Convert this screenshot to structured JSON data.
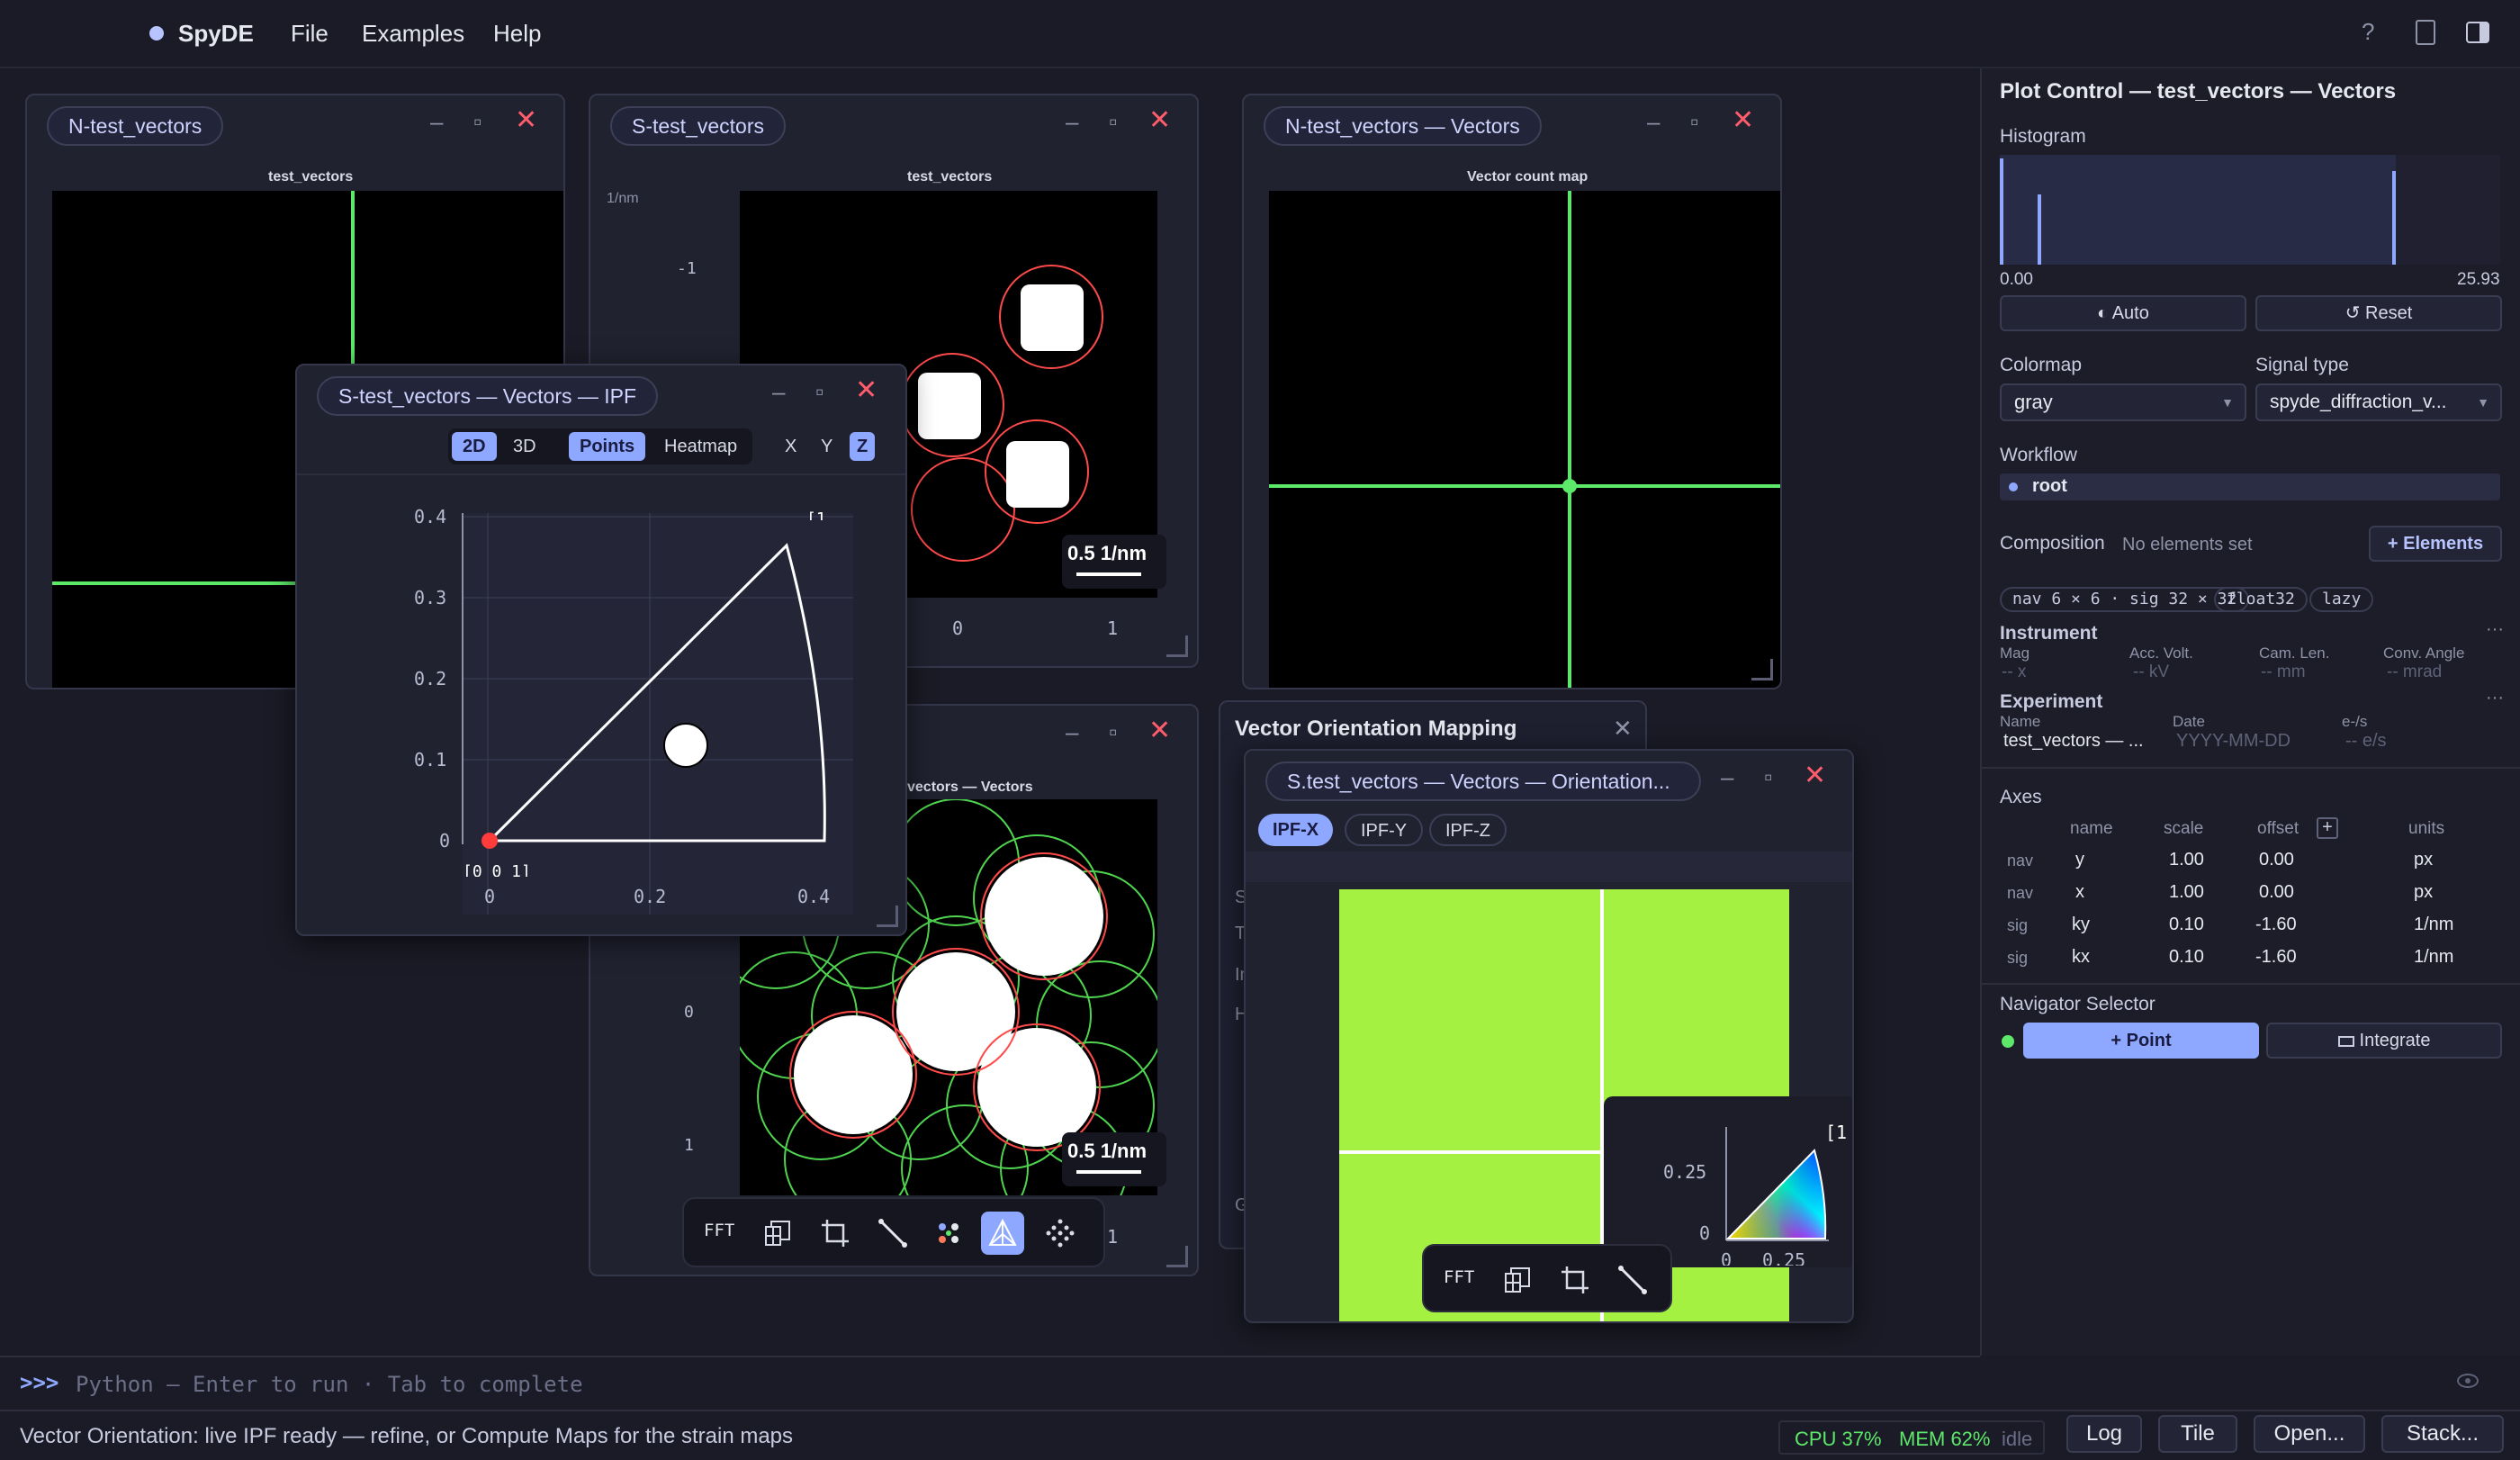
{
  "app": {
    "name": "SpyDE",
    "menu": [
      "File",
      "Examples",
      "Help"
    ],
    "accent": "#8fa8ff"
  },
  "header_icons": [
    "help-icon",
    "document-icon",
    "sidebar-toggle-icon"
  ],
  "windows": {
    "n_vectors": {
      "tab": "N-test_vectors",
      "title": "test_vectors"
    },
    "s_vectors": {
      "tab": "S-test_vectors",
      "title": "test_vectors",
      "unit": "1/nm",
      "y_tick": "-1",
      "x_ticks": [
        "0",
        "1"
      ],
      "scalebar": "0.5 1/nm"
    },
    "n_vectors_vec": {
      "tab": "N-test_vectors — Vectors",
      "title": "Vector count map"
    },
    "ipf": {
      "tab": "S-test_vectors — Vectors — IPF",
      "modes": [
        "2D",
        "3D",
        "Points",
        "Heatmap",
        "X",
        "Y",
        "Z"
      ],
      "y_ticks": [
        "0.4",
        "0.3",
        "0.2",
        "0.1",
        "0"
      ],
      "x_ticks": [
        "0",
        "0.2",
        "0.4"
      ],
      "corner_label": "[0 0 1]",
      "corner_label_top": "[1",
      "point": {
        "x": 0.24,
        "y": 0.12
      }
    },
    "s_vectors_vec": {
      "title": "vectors — Vectors",
      "y_ticks": [
        "0",
        "1"
      ],
      "x_tick": "1",
      "scalebar": "0.5 1/nm"
    },
    "vom": {
      "title": "Vector Orientation Mapping",
      "side_letters": [
        "S",
        "T",
        "In",
        "H",
        "G"
      ]
    },
    "orientation": {
      "tab": "S.test_vectors — Vectors — Orientation...",
      "tabs": [
        "IPF-X",
        "IPF-Y",
        "IPF-Z"
      ],
      "key_y_ticks": [
        "0.25",
        "0"
      ],
      "key_x_ticks": [
        "0",
        "0.25"
      ],
      "key_label": "[1"
    }
  },
  "toolbar": {
    "fft": "FFT",
    "icons": [
      "symmetry-icon",
      "crop-icon",
      "line-icon",
      "vectors-icon",
      "ipf-icon",
      "grid-points-icon"
    ]
  },
  "toolbar2": {
    "fft": "FFT",
    "icons": [
      "symmetry-icon",
      "crop-icon",
      "line-icon"
    ]
  },
  "panel": {
    "title": "Plot Control — test_vectors — Vectors",
    "histogram": {
      "label": "Histogram",
      "min": "0.00",
      "max": "25.93"
    },
    "auto_label": "Auto",
    "reset_label": "Reset",
    "colormap_label": "Colormap",
    "colormap": "gray",
    "signal_type_label": "Signal type",
    "signal_type": "spyde_diffraction_v...",
    "workflow_label": "Workflow",
    "workflow_root": "root",
    "composition_label": "Composition",
    "composition_value": "No elements set",
    "elements_button": "+ Elements",
    "chips": [
      "nav 6 × 6 · sig 32 × 32",
      "float32",
      "lazy"
    ],
    "instrument": {
      "label": "Instrument",
      "fields": [
        {
          "name": "Mag",
          "value": "-- x"
        },
        {
          "name": "Acc. Volt.",
          "value": "-- kV"
        },
        {
          "name": "Cam. Len.",
          "value": "-- mm"
        },
        {
          "name": "Conv. Angle",
          "value": "-- mrad"
        }
      ]
    },
    "experiment": {
      "label": "Experiment",
      "fields": [
        {
          "name": "Name",
          "value": "test_vectors — ..."
        },
        {
          "name": "Date",
          "value": "YYYY-MM-DD"
        },
        {
          "name": "e-/s",
          "value": "-- e/s"
        }
      ]
    },
    "axes": {
      "label": "Axes",
      "headers": [
        "name",
        "scale",
        "offset",
        "units"
      ],
      "rows": [
        {
          "kind": "nav",
          "name": "y",
          "scale": "1.00",
          "offset": "0.00",
          "units": "px"
        },
        {
          "kind": "nav",
          "name": "x",
          "scale": "1.00",
          "offset": "0.00",
          "units": "px"
        },
        {
          "kind": "sig",
          "name": "ky",
          "scale": "0.10",
          "offset": "-1.60",
          "units": "1/nm"
        },
        {
          "kind": "sig",
          "name": "kx",
          "scale": "0.10",
          "offset": "-1.60",
          "units": "1/nm"
        }
      ]
    },
    "navigator_label": "Navigator Selector",
    "point_button": "+ Point",
    "integrate_button": "Integrate"
  },
  "console": {
    "prompt": ">>>",
    "placeholder": "Python — Enter to run · Tab to complete"
  },
  "status": {
    "message": "Vector Orientation: live IPF ready — refine, or Compute Maps for the strain maps",
    "cpu": "CPU 37%",
    "mem": "MEM 62%",
    "state": "idle",
    "buttons": [
      "Log",
      "Tile",
      "Open...",
      "Stack..."
    ]
  }
}
